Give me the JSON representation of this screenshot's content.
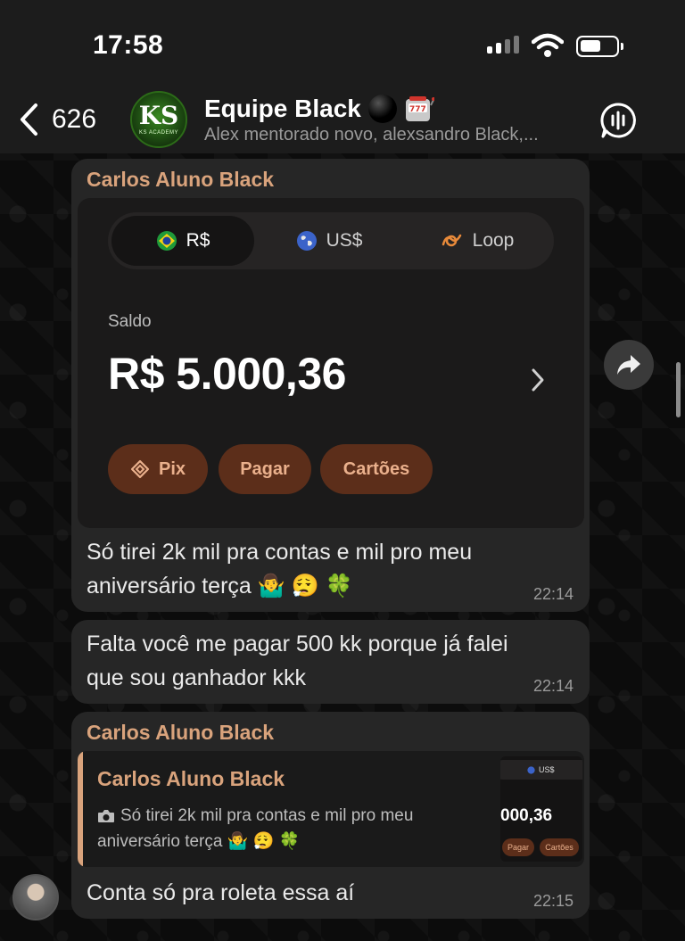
{
  "status_bar": {
    "time": "17:58"
  },
  "header": {
    "back_count": "626",
    "avatar_text": "KS",
    "avatar_sub": "KS ACADEMY",
    "title": "Equipe Black",
    "subtitle": "Alex mentorado novo, alexsandro Black,..."
  },
  "messages": [
    {
      "sender": "Carlos Aluno Black",
      "image": {
        "tabs": [
          {
            "label": "R$",
            "icon": "brazil-flag-icon"
          },
          {
            "label": "US$",
            "icon": "globe-icon"
          },
          {
            "label": "Loop",
            "icon": "loop-icon"
          }
        ],
        "balance_label": "Saldo",
        "balance_value": "R$ 5.000,36",
        "actions": [
          {
            "label": "Pix",
            "icon": "pix-icon"
          },
          {
            "label": "Pagar"
          },
          {
            "label": "Cartões"
          }
        ]
      },
      "text_line1": "Só tirei 2k mil pra contas e mil pro meu",
      "text_line2": "aniversário terça 🤷‍♂️ 😮‍💨 🍀",
      "time": "22:14"
    },
    {
      "text_line1": "Falta você me pagar 500 kk porque já falei",
      "text_line2": "que sou ganhador kkk",
      "time": "22:14"
    },
    {
      "sender": "Carlos Aluno Black",
      "quote": {
        "sender": "Carlos Aluno Black",
        "text_line1": "Só tirei 2k mil pra contas e mil pro meu",
        "text_line2": "aniversário terça 🤷‍♂️ 😮‍💨 🍀",
        "thumb_tab": "US$",
        "thumb_balance": "000,36",
        "thumb_actions": [
          "Pagar",
          "Cartões"
        ]
      },
      "text": "Conta só pra roleta essa aí",
      "time": "22:15"
    }
  ],
  "colors": {
    "sender": "#d9a37c",
    "bubble": "#262626",
    "action_pill": "#5c2e1a",
    "header_bg": "#1c1c1c"
  }
}
